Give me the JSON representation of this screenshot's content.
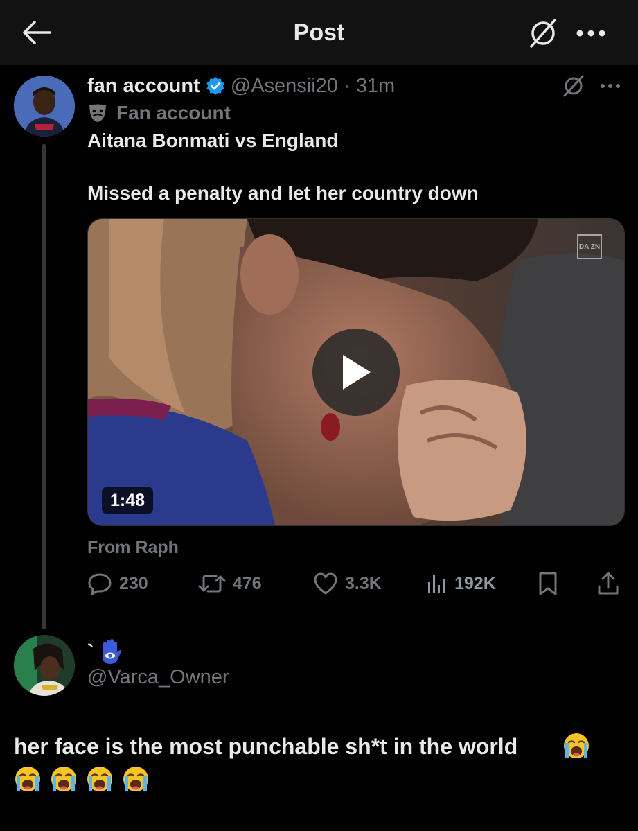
{
  "header": {
    "title": "Post",
    "back_icon": "arrow-left-icon",
    "grok_icon": "grok-icon",
    "more_icon": "more-icon"
  },
  "post": {
    "author_name": "fan account",
    "verified": true,
    "handle": "@Asensii20 · 31m",
    "label": "Fan account",
    "text": "Aitana Bonmati vs England\n\nMissed a penalty and let her country down",
    "media": {
      "type": "video",
      "duration": "1:48",
      "watermark": "DA ZN"
    },
    "source": "From Raph",
    "stats": {
      "replies": "230",
      "reposts": "476",
      "likes": "3.3K",
      "views": "192K"
    }
  },
  "reply": {
    "name": "`",
    "name_icon": "hamsa-icon",
    "handle": "@Varca_Owner",
    "text": "her face is the most punchable sh*t in the world",
    "emoji": "loudly-crying-face",
    "emoji_count": 5
  },
  "colors": {
    "background": "#000000",
    "header_bg": "#121212",
    "text_primary": "#e7e9ea",
    "text_secondary": "#71767b",
    "verified_blue": "#1d9bf0"
  }
}
